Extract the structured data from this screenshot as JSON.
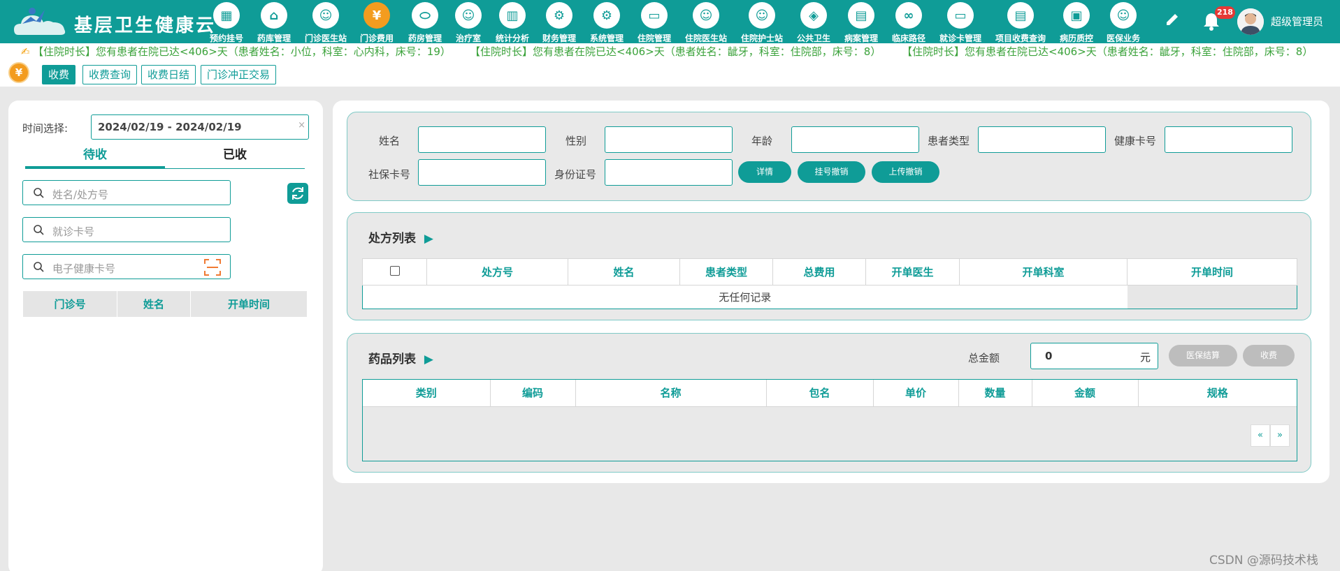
{
  "app": {
    "title": "基层卫生健康云",
    "user": "超级管理员",
    "notification_count": "218"
  },
  "nav": [
    {
      "label": "预约挂号",
      "icon": "calendar-icon",
      "glyph": "▦"
    },
    {
      "label": "药库管理",
      "icon": "warehouse-icon",
      "glyph": "⌂"
    },
    {
      "label": "门诊医生站",
      "icon": "doctor-icon",
      "glyph": "☺"
    },
    {
      "label": "门诊费用",
      "icon": "yen-icon",
      "glyph": "¥"
    },
    {
      "label": "药房管理",
      "icon": "pill-icon",
      "glyph": "⬭"
    },
    {
      "label": "治疗室",
      "icon": "nurse-icon",
      "glyph": "☺"
    },
    {
      "label": "统计分析",
      "icon": "chart-icon",
      "glyph": "▥"
    },
    {
      "label": "财务管理",
      "icon": "finance-gear-icon",
      "glyph": "⚙"
    },
    {
      "label": "系统管理",
      "icon": "settings-icon",
      "glyph": "⚙"
    },
    {
      "label": "住院管理",
      "icon": "bed-icon",
      "glyph": "▭"
    },
    {
      "label": "住院医生站",
      "icon": "inpatient-doctor-icon",
      "glyph": "☺"
    },
    {
      "label": "住院护士站",
      "icon": "inpatient-nurse-icon",
      "glyph": "☺"
    },
    {
      "label": "公共卫生",
      "icon": "public-health-icon",
      "glyph": "◈"
    },
    {
      "label": "病案管理",
      "icon": "record-icon",
      "glyph": "▤"
    },
    {
      "label": "临床路径",
      "icon": "path-icon",
      "glyph": "∞"
    },
    {
      "label": "就诊卡管理",
      "icon": "card-icon",
      "glyph": "▭"
    },
    {
      "label": "项目收费查询",
      "icon": "fee-query-icon",
      "glyph": "▤"
    },
    {
      "label": "病历质控",
      "icon": "quality-icon",
      "glyph": "▣"
    },
    {
      "label": "医保业务",
      "icon": "insurance-icon",
      "glyph": "☺"
    }
  ],
  "ticker": [
    "【住院时长】您有患者在院已达<406>天（患者姓名：小位，科室：心内科，床号：19）",
    "【住院时长】您有患者在院已达<406>天（患者姓名：龇牙，科室：住院部，床号：8）",
    "【住院时长】您有患者在院已达<406>天（患者姓名：龇牙，科室：住院部，床号：8）"
  ],
  "toolbar": {
    "items": [
      "收费",
      "收费查询",
      "收费日结",
      "门诊冲正交易"
    ]
  },
  "left": {
    "time_label": "时间选择:",
    "date_range": "2024/02/19 - 2024/02/19",
    "tabs": [
      "待收",
      "已收"
    ],
    "search_name_ph": "姓名/处方号",
    "search_card_ph": "就诊卡号",
    "search_health_ph": "电子健康卡号",
    "table_headers": [
      "门诊号",
      "姓名",
      "开单时间"
    ]
  },
  "patient_form": {
    "labels": [
      "姓名",
      "性别",
      "年龄",
      "患者类型",
      "健康卡号",
      "社保卡号",
      "身份证号"
    ],
    "buttons": [
      "详情",
      "挂号撤销",
      "上传撤销"
    ]
  },
  "prescription": {
    "title": "处方列表",
    "headers": [
      "处方号",
      "姓名",
      "患者类型",
      "总费用",
      "开单医生",
      "开单科室",
      "开单时间"
    ],
    "empty": "无任何记录"
  },
  "drugs": {
    "title": "药品列表",
    "total_label": "总金额",
    "total_value": "0",
    "unit": "元",
    "buttons": [
      "医保结算",
      "收费"
    ],
    "headers": [
      "类别",
      "编码",
      "名称",
      "包名",
      "单价",
      "数量",
      "金额",
      "规格"
    ],
    "pager": [
      "«",
      "»"
    ]
  },
  "watermark": "CSDN @源码技术栈"
}
